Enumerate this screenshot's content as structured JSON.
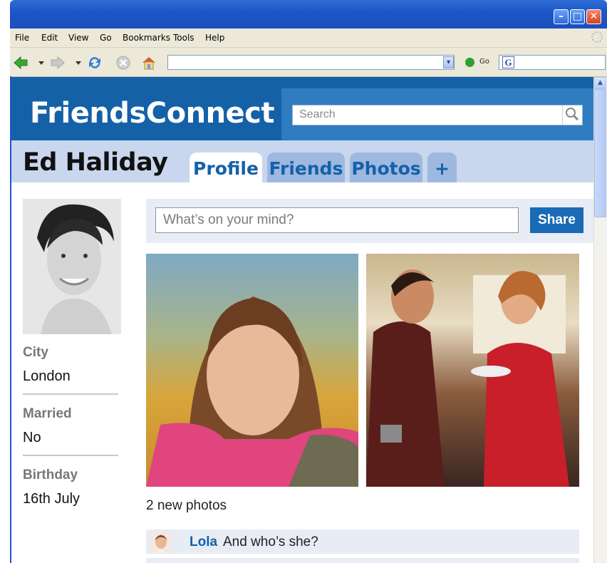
{
  "browser": {
    "menu": [
      "File",
      "Edit",
      "View",
      "Go",
      "Bookmarks",
      "Tools",
      "Help"
    ],
    "address_value": "",
    "go_label": "Go",
    "window_buttons": {
      "minimize": "–",
      "maximize": "□",
      "close": "✕"
    },
    "google_glyph": "G"
  },
  "site": {
    "brand": "FriendsConnect",
    "search_placeholder": "Search",
    "accent": "#1461a8"
  },
  "profile": {
    "name": "Ed Haliday",
    "tabs": [
      {
        "label": "Profile",
        "active": true
      },
      {
        "label": "Friends",
        "active": false
      },
      {
        "label": "Photos",
        "active": false
      },
      {
        "label": "+",
        "active": false
      }
    ],
    "info": [
      {
        "label": "City",
        "value": "London"
      },
      {
        "label": "Married",
        "value": "No"
      },
      {
        "label": "Birthday",
        "value": "16th July"
      }
    ]
  },
  "feed": {
    "status_placeholder": "What’s on your mind?",
    "share_label": "Share",
    "photos_caption": "2 new photos",
    "comment": {
      "name": "Lola",
      "text": "And who’s she?"
    }
  },
  "icons": [
    "back-arrow-icon",
    "forward-arrow-icon",
    "refresh-icon",
    "stop-icon",
    "home-icon",
    "go-icon",
    "search-icon",
    "dropdown-arrow-icon"
  ]
}
